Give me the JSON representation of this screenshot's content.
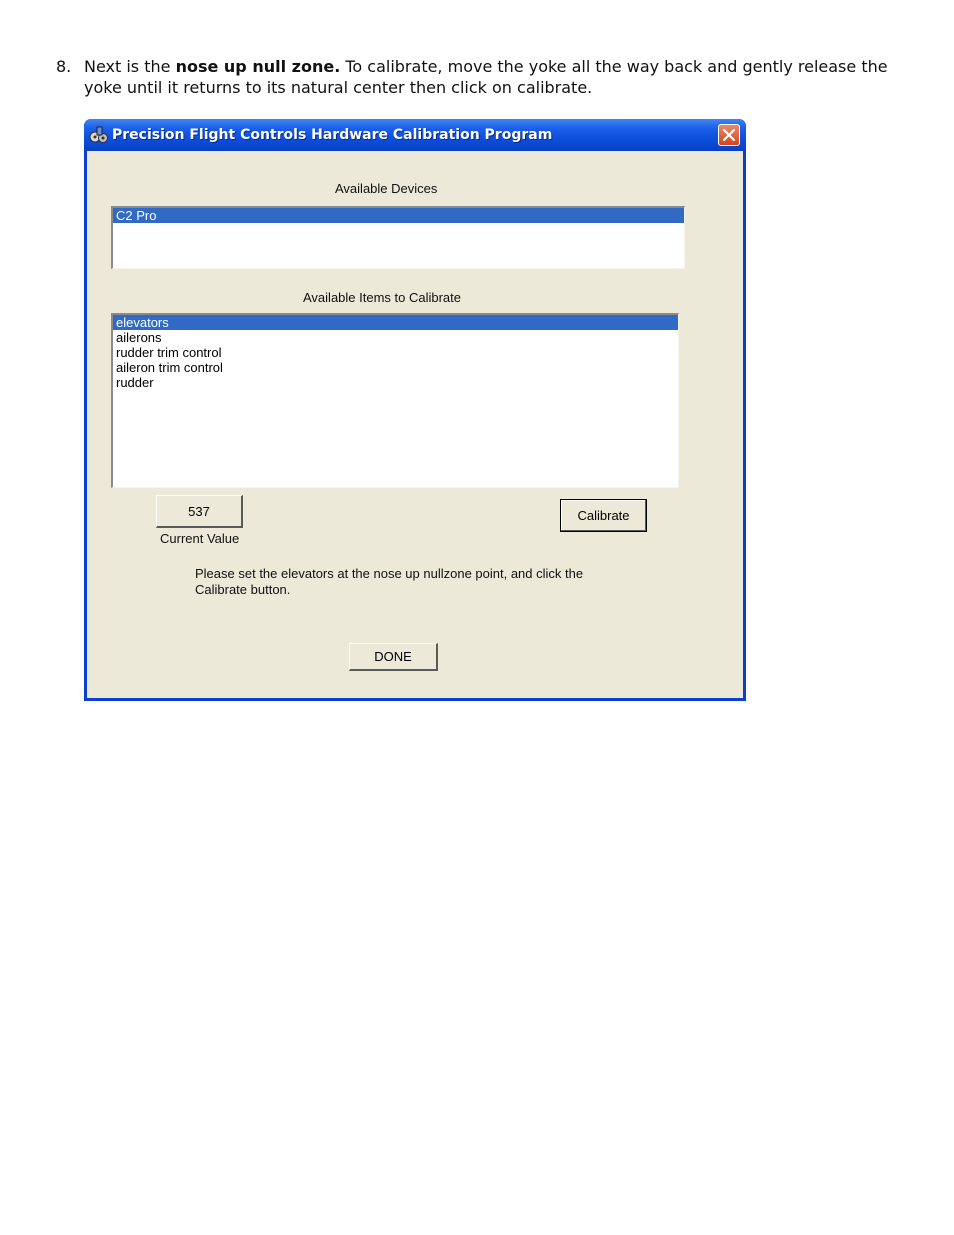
{
  "instruction": {
    "number": "8.",
    "prefix": "Next is the ",
    "bold": "nose up null zone.",
    "suffix": " To calibrate, move the yoke all the way back and gently release the yoke until it returns to its natural center then click on calibrate."
  },
  "window": {
    "title": "Precision Flight Controls Hardware Calibration Program",
    "devices_label": "Available Devices",
    "devices": [
      "C2 Pro"
    ],
    "selected_device": "C2 Pro",
    "items_label": "Available Items to Calibrate",
    "items": [
      "elevators",
      "ailerons",
      "rudder trim control",
      "aileron trim control",
      "rudder"
    ],
    "selected_item": "elevators",
    "current_value": "537",
    "current_value_label": "Current Value",
    "calibrate_label": "Calibrate",
    "message": "Please set the elevators at the nose up nullzone point, and click the Calibrate button.",
    "done_label": "DONE"
  },
  "colors": {
    "title_bar": "#0a4bd8",
    "selection": "#316ac5",
    "dialog_face": "#ece9d8"
  },
  "icons": {
    "app": "aircraft-controls-icon",
    "close": "close-icon"
  }
}
